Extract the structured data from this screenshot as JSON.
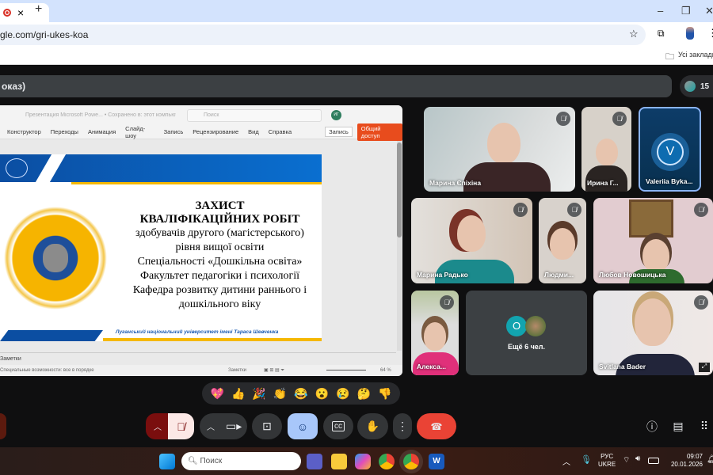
{
  "browser": {
    "url": "gle.com/gri-ukes-koa",
    "bookmarks_label": "Усі закладки",
    "close_tab": "×",
    "new_tab": "+",
    "minimize": "–",
    "restore": "❐",
    "close": "✕"
  },
  "meet": {
    "title": "оказ)",
    "participant_count": "15"
  },
  "ppt": {
    "window_title": "Презентация Microsoft Powe... • Сохранено в: этот компьютер",
    "search_placeholder": "Поиск",
    "avatar": "ИГ",
    "ribbon_tabs": [
      "Конструктор",
      "Переходы",
      "Анимация",
      "Слайд-шоу",
      "Запись",
      "Рецензирование",
      "Вид",
      "Справка"
    ],
    "record_button": "Запись",
    "share_button": "Общий доступ",
    "notes_label": "Заметки",
    "status_text": "Специальные возможности: все в порядке",
    "notes_button": "Заметки",
    "zoom": "64 %"
  },
  "slide": {
    "title1": "ЗАХИСТ",
    "title2": "КВАЛІФІКАЦІЙНИХ РОБІТ",
    "lines": [
      "здобувачів другого (магістерського)",
      "рівня вищої освіти",
      "Спеціальності «Дошкільна освіта»",
      "Факультет педагогіки і психології",
      "Кафедра розвитку дитини раннього і",
      "дошкільного віку"
    ],
    "footer": "Луганський національний університет імені Тараса Шевченка"
  },
  "participants": [
    {
      "name": "Марина Єпіхіна"
    },
    {
      "name": "Ирина Г..."
    },
    {
      "name": "Valeriia Byka...",
      "initial": "V"
    },
    {
      "name": "Марина Радько"
    },
    {
      "name": "Людми..."
    },
    {
      "name": "Любов Новошицька"
    },
    {
      "name": "Алекса..."
    },
    {
      "name": "Svitlana Bader"
    }
  ],
  "more": {
    "label": "Ещё 6 чел.",
    "initial": "O"
  },
  "reactions": [
    "💖",
    "👍",
    "🎉",
    "👏",
    "😂",
    "😮",
    "😢",
    "🤔",
    "👎"
  ],
  "taskbar": {
    "search_placeholder": "Поиск",
    "lang1": "РУС",
    "lang2": "UKRE",
    "time": "09:07",
    "date": "20.01.2026"
  },
  "colors": {
    "end_call": "#ea4335",
    "emoji_active": "#a8c7fa",
    "mic_off": "#fce8e6",
    "accent_border": "#8ab4f8"
  }
}
